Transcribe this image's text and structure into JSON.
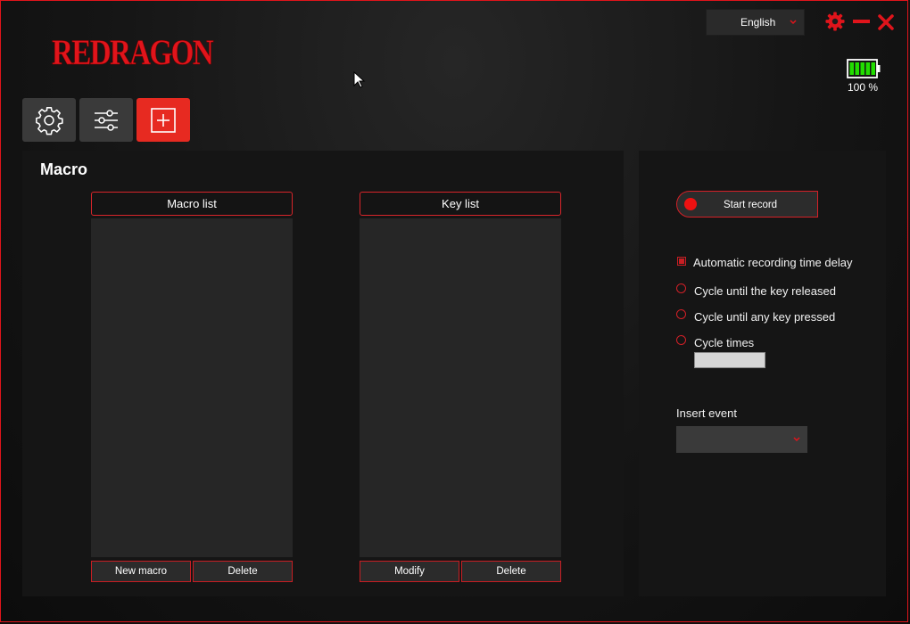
{
  "brand": {
    "logo_text": "REDRAGON"
  },
  "header": {
    "language": {
      "selected": "English"
    },
    "battery": {
      "level_percent": 100,
      "label": "100 %"
    }
  },
  "tabs": [
    {
      "icon": "gear-icon",
      "active": false
    },
    {
      "icon": "sliders-icon",
      "active": false
    },
    {
      "icon": "plus-square-icon",
      "active": true
    }
  ],
  "macro": {
    "title": "Macro",
    "macro_list": {
      "header": "Macro list",
      "items": [],
      "new_label": "New macro",
      "delete_label": "Delete"
    },
    "key_list": {
      "header": "Key list",
      "items": [],
      "modify_label": "Modify",
      "delete_label": "Delete"
    }
  },
  "recording": {
    "start_label": "Start record",
    "auto_delay_label": "Automatic recording time delay",
    "auto_delay_checked": true,
    "options": [
      {
        "label": "Cycle until the key released",
        "selected": false
      },
      {
        "label": "Cycle until any key pressed",
        "selected": false
      },
      {
        "label": "Cycle times",
        "selected": false
      }
    ],
    "cycle_times_value": "",
    "insert_event_label": "Insert event",
    "insert_event_value": ""
  },
  "colors": {
    "accent": "#e72a21",
    "panel": "#151515",
    "list_bg": "#262626",
    "battery_green": "#22dd00"
  }
}
